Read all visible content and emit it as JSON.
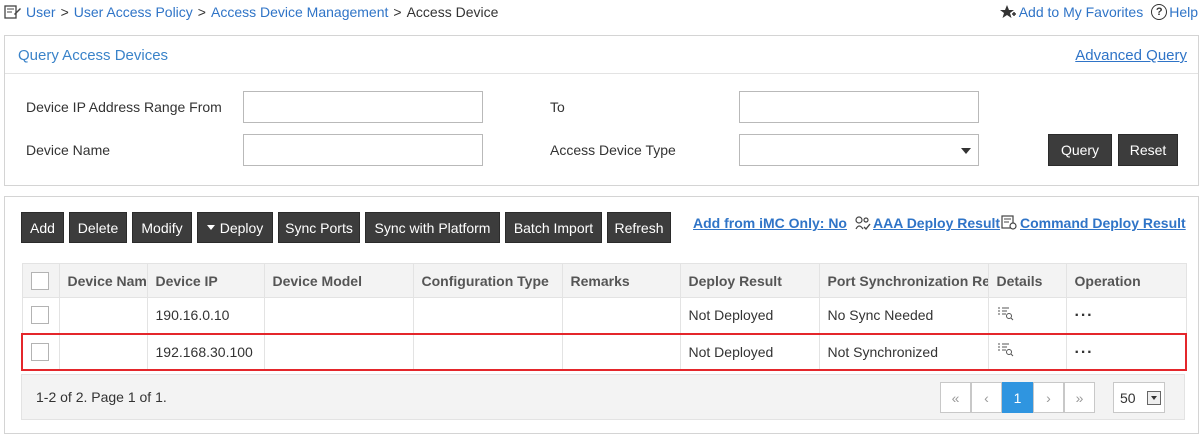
{
  "breadcrumb": {
    "items": [
      "User",
      "User Access Policy",
      "Access Device Management"
    ],
    "current": "Access Device",
    "separator": ">"
  },
  "top_links": {
    "favorites": "Add to My Favorites",
    "help": "Help"
  },
  "query": {
    "title": "Query Access Devices",
    "advanced": "Advanced Query",
    "ip_from_label": "Device IP Address Range From",
    "ip_from_value": "",
    "to_label": "To",
    "to_value": "",
    "device_name_label": "Device Name",
    "device_name_value": "",
    "device_type_label": "Access Device Type",
    "device_type_value": "",
    "query_button": "Query",
    "reset_button": "Reset"
  },
  "toolbar": {
    "add": "Add",
    "delete": "Delete",
    "modify": "Modify",
    "deploy": "Deploy",
    "sync_ports": "Sync Ports",
    "sync_platform": "Sync with Platform",
    "batch_import": "Batch Import",
    "refresh": "Refresh",
    "imc_only": "Add from iMC Only: No",
    "aaa_result": "AAA Deploy Result",
    "command_result": "Command Deploy Result"
  },
  "table": {
    "columns": [
      "Device Nam",
      "Device IP",
      "Device Model",
      "Configuration Type",
      "Remarks",
      "Deploy Result",
      "Port Synchronization Re:",
      "Details",
      "Operation"
    ],
    "rows": [
      {
        "name": "",
        "ip": "190.16.0.10",
        "model": "",
        "config": "",
        "remarks": "",
        "deploy": "Not Deployed",
        "port_sync": "No Sync Needed",
        "operation": "···"
      },
      {
        "name": "",
        "ip": "192.168.30.100",
        "model": "",
        "config": "",
        "remarks": "",
        "deploy": "Not Deployed",
        "port_sync": "Not Synchronized",
        "operation": "···"
      }
    ]
  },
  "pager": {
    "info": "1-2 of 2. Page 1 of 1.",
    "first": "«",
    "prev": "‹",
    "current_page": "1",
    "next": "›",
    "last": "»",
    "page_size": "50"
  },
  "colors": {
    "link": "#2f74c7",
    "button_bg": "#3c3c3c",
    "highlight": "#e4262b",
    "active_page": "#2f95e0"
  }
}
